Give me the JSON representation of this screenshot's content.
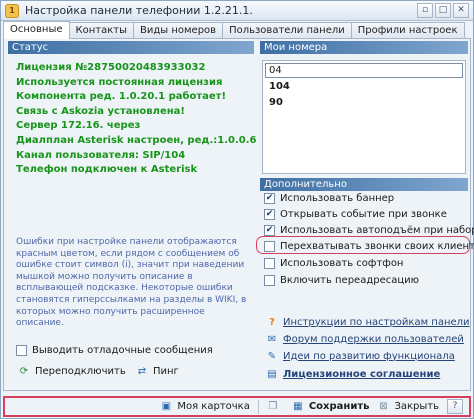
{
  "window": {
    "title": "Настройка панели телефонии 1.2.21.1.",
    "controls": [
      "▫",
      "□",
      "✕"
    ]
  },
  "tabs": [
    {
      "label": "Основные"
    },
    {
      "label": "Контакты"
    },
    {
      "label": "Виды номеров"
    },
    {
      "label": "Пользователи панели"
    },
    {
      "label": "Профили настроек"
    }
  ],
  "status": {
    "header": "Статус",
    "lines": [
      "Лицензия №28750020483933032",
      "Используется постоянная лицензия",
      "Компонента ред. 1.0.20.1 работает!",
      "Связь с Askozia установлена!",
      "Сервер 172.16.        через",
      "Диалплан Asterisk настроен, ред.:1.0.0.6",
      "Канал пользователя: SIP/104",
      "Телефон подключен к Asterisk"
    ],
    "hint": "Ошибки при настройке панели отображаются красным цветом, если рядом с сообщением об ошибке стоит символ (i), значит при наведении мышкой можно получить описание в всплывающей подсказке. Некоторые ошибки становятся гиперссылками на разделы в WIKI, в которых можно получить расширенное описание.",
    "debug_label": "Выводить отладочные сообщения",
    "reconnect_label": "Переподключить",
    "ping_label": "Пинг"
  },
  "my_numbers": {
    "header": "Мои номера",
    "input_value": "04",
    "items": [
      "104",
      "90"
    ]
  },
  "additional": {
    "header": "Дополнительно",
    "options": [
      {
        "label": "Использовать баннер",
        "checked": "✔"
      },
      {
        "label": "Открывать событие при звонке",
        "checked": "✔"
      },
      {
        "label": "Использовать автоподъём при наборе",
        "checked": "✔"
      },
      {
        "label": "Перехватывать звонки своих клиентов",
        "checked": ""
      },
      {
        "label": "Использовать софтфон",
        "checked": ""
      },
      {
        "label": "Включить переадресацию",
        "checked": ""
      }
    ]
  },
  "links": [
    {
      "label": "Инструкции по настройкам панели",
      "icon": "question-icon"
    },
    {
      "label": "Форум поддержки пользователей",
      "icon": "chat-icon"
    },
    {
      "label": "Идеи по развитию функционала",
      "icon": "lightbulb-icon"
    },
    {
      "label": "Лицензионное соглашение",
      "icon": "document-icon"
    }
  ],
  "bottom": {
    "my_card": "Моя карточка",
    "save": "Сохранить",
    "close": "Закрыть",
    "help": "?"
  },
  "colors": {
    "status_ok": "#18941a",
    "header_blue": "#3f6fa3",
    "highlight": "#d6405c",
    "hint": "#4f68a8"
  }
}
